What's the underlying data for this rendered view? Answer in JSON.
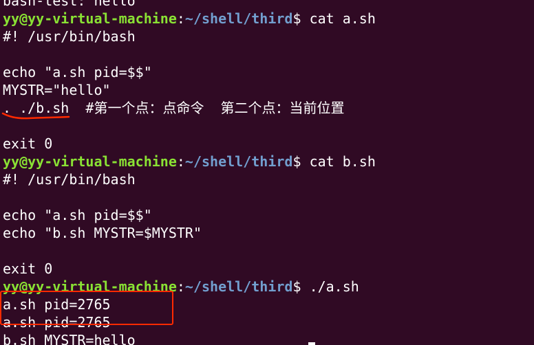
{
  "terminal": {
    "lines": [
      {
        "kind": "text",
        "text": "bash-test: hello"
      },
      {
        "kind": "prompt",
        "user": "yy@yy-virtual-machine",
        "sep": ":",
        "path": "~/shell/third",
        "dollar": "$ ",
        "command": "cat a.sh"
      },
      {
        "kind": "text",
        "text": "#! /usr/bin/bash"
      },
      {
        "kind": "text",
        "text": ""
      },
      {
        "kind": "text",
        "text": "echo \"a.sh pid=$$\""
      },
      {
        "kind": "text",
        "text": "MYSTR=\"hello\""
      },
      {
        "kind": "text",
        "text": ". ./b.sh  #第一个点：点命令  第二个点：当前位置"
      },
      {
        "kind": "text",
        "text": ""
      },
      {
        "kind": "text",
        "text": "exit 0"
      },
      {
        "kind": "prompt",
        "user": "yy@yy-virtual-machine",
        "sep": ":",
        "path": "~/shell/third",
        "dollar": "$ ",
        "command": "cat b.sh"
      },
      {
        "kind": "text",
        "text": "#! /usr/bin/bash"
      },
      {
        "kind": "text",
        "text": ""
      },
      {
        "kind": "text",
        "text": "echo \"a.sh pid=$$\""
      },
      {
        "kind": "text",
        "text": "echo \"b.sh MYSTR=$MYSTR\""
      },
      {
        "kind": "text",
        "text": ""
      },
      {
        "kind": "text",
        "text": "exit 0"
      },
      {
        "kind": "prompt",
        "user": "yy@yy-virtual-machine",
        "sep": ":",
        "path": "~/shell/third",
        "dollar": "$ ",
        "command": "./a.sh"
      },
      {
        "kind": "text",
        "text": "a.sh pid=2765"
      },
      {
        "kind": "text",
        "text": "a.sh pid=2765"
      },
      {
        "kind": "text",
        "text": "b.sh MYSTR=hello"
      }
    ]
  },
  "colors": {
    "background": "#300a24",
    "prompt_user": "#8ae234",
    "prompt_path": "#729fcf",
    "annotation_red": "#ff2a00"
  }
}
